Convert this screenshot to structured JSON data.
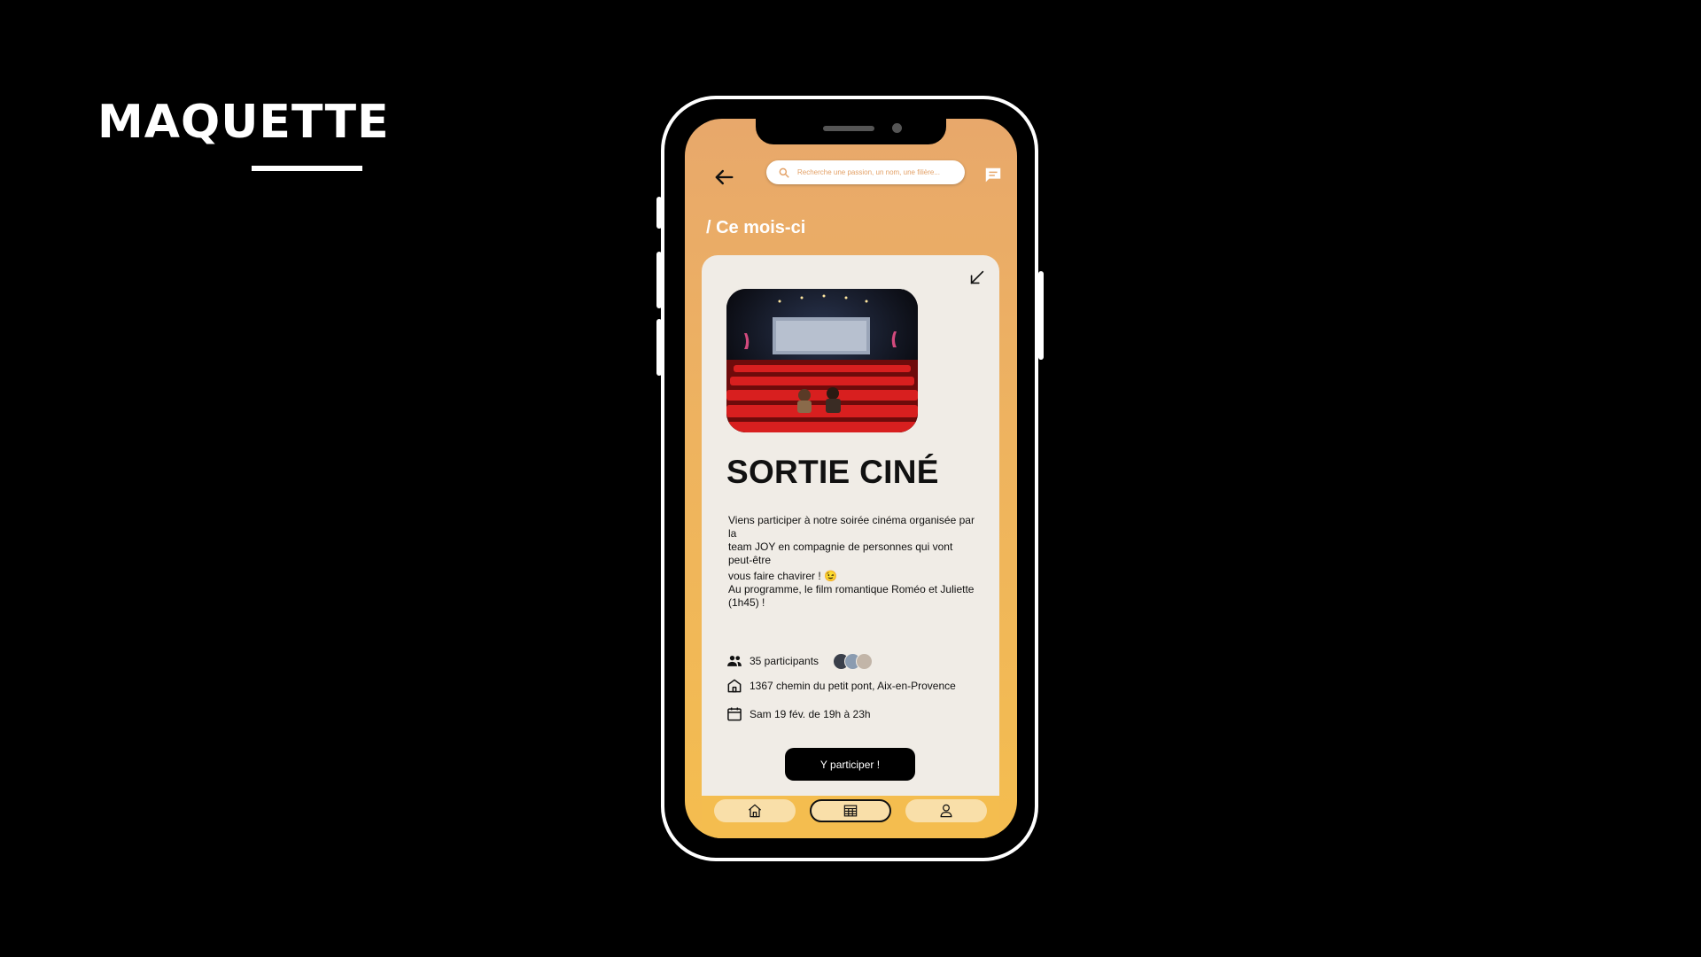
{
  "slide": {
    "title": "MAQUETTE"
  },
  "app": {
    "search": {
      "placeholder": "Recherche une passion, un nom, une filière..."
    },
    "section_title": "/ Ce mois-ci",
    "event": {
      "title": "SORTIE CINÉ",
      "description_lines": [
        "Viens participer à notre soirée cinéma organisée par la",
        "team JOY en compagnie de personnes qui vont peut-être",
        "vous faire chavirer ! 😉",
        "Au programme, le film romantique Roméo et Juliette (1h45) !"
      ],
      "participants": "35 participants",
      "address": "1367 chemin du petit pont, Aix-en-Provence",
      "date": "Sam 19 fév. de 19h à 23h",
      "cta_label": "Y participer !"
    },
    "nav": [
      {
        "name": "home-icon",
        "active": false
      },
      {
        "name": "calendar-icon",
        "active": true
      },
      {
        "name": "profile-icon",
        "active": false
      }
    ],
    "colors": {
      "gradient_top": "#e8a86b",
      "gradient_bottom": "#f4bd4f",
      "card_bg": "#f0ece6",
      "accent": "#000000"
    }
  }
}
